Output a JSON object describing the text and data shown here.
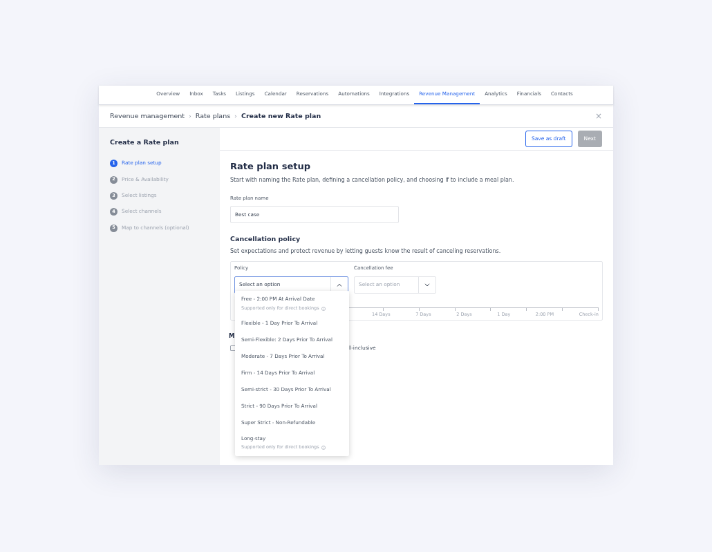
{
  "nav": {
    "items": [
      {
        "label": "Overview",
        "selected": false
      },
      {
        "label": "Inbox",
        "selected": false
      },
      {
        "label": "Tasks",
        "selected": false
      },
      {
        "label": "Listings",
        "selected": false
      },
      {
        "label": "Calendar",
        "selected": false
      },
      {
        "label": "Reservations",
        "selected": false
      },
      {
        "label": "Automations",
        "selected": false
      },
      {
        "label": "Integrations",
        "selected": false
      },
      {
        "label": "Revenue Management",
        "selected": true
      },
      {
        "label": "Analytics",
        "selected": false
      },
      {
        "label": "Financials",
        "selected": false
      },
      {
        "label": "Contacts",
        "selected": false
      }
    ]
  },
  "breadcrumb": [
    "Revenue management",
    "Rate plans",
    "Create new Rate plan"
  ],
  "breadcrumb_separator": "›",
  "close": "×",
  "sidebar": {
    "title": "Create a Rate plan",
    "steps": [
      {
        "number": "1",
        "label": "Rate plan setup",
        "selected": true
      },
      {
        "number": "2",
        "label": "Price & Availability",
        "selected": false
      },
      {
        "number": "3",
        "label": "Select listings",
        "selected": false
      },
      {
        "number": "4",
        "label": "Select channels",
        "selected": false
      },
      {
        "number": "5",
        "label": "Map to channels (optional)",
        "selected": false
      }
    ]
  },
  "toolbar": {
    "save_draft": "Save as draft",
    "next": {
      "label": "Next",
      "disabled": true
    }
  },
  "setup": {
    "title": "Rate plan setup",
    "description": "Start with naming the Rate plan, defining a cancellation policy, and choosing if to include a meal plan.",
    "name_label": "Rate plan name",
    "name_value": "Best case"
  },
  "cancellation": {
    "title": "Cancellation policy",
    "description": "Set expectations and protect revenue by letting guests know the result of canceling reservations.",
    "policy": {
      "label": "Policy",
      "value": "Select an option",
      "expanded": true
    },
    "fee": {
      "label": "Cancellation fee",
      "placeholder": "Select an option",
      "expanded": false
    },
    "timeline": [
      "14 Days",
      "7 Days",
      "2 Days",
      "1 Day",
      "2:00 PM",
      "Check-in"
    ],
    "options": [
      {
        "label": "Free - 2:00 PM At Arrival Date",
        "note": "Supported only for direct bookings"
      },
      {
        "label": "Flexible - 1 Day Prior To Arrival"
      },
      {
        "label": "Semi-Flexible: 2 Days Prior To Arrival"
      },
      {
        "label": "Moderate - 7 Days Prior To Arrival"
      },
      {
        "label": "Firm - 14 Days Prior To Arrival"
      },
      {
        "label": "Semi-strict - 30 Days Prior To Arrival"
      },
      {
        "label": "Strict - 90 Days Prior To Arrival"
      },
      {
        "label": "Super Strict - Non-Refundable"
      },
      {
        "label": "Long-stay",
        "note": "Supported only for direct bookings"
      }
    ]
  },
  "meal": {
    "title": "M",
    "option": {
      "label": "ll-inclusive",
      "checked": false
    }
  }
}
